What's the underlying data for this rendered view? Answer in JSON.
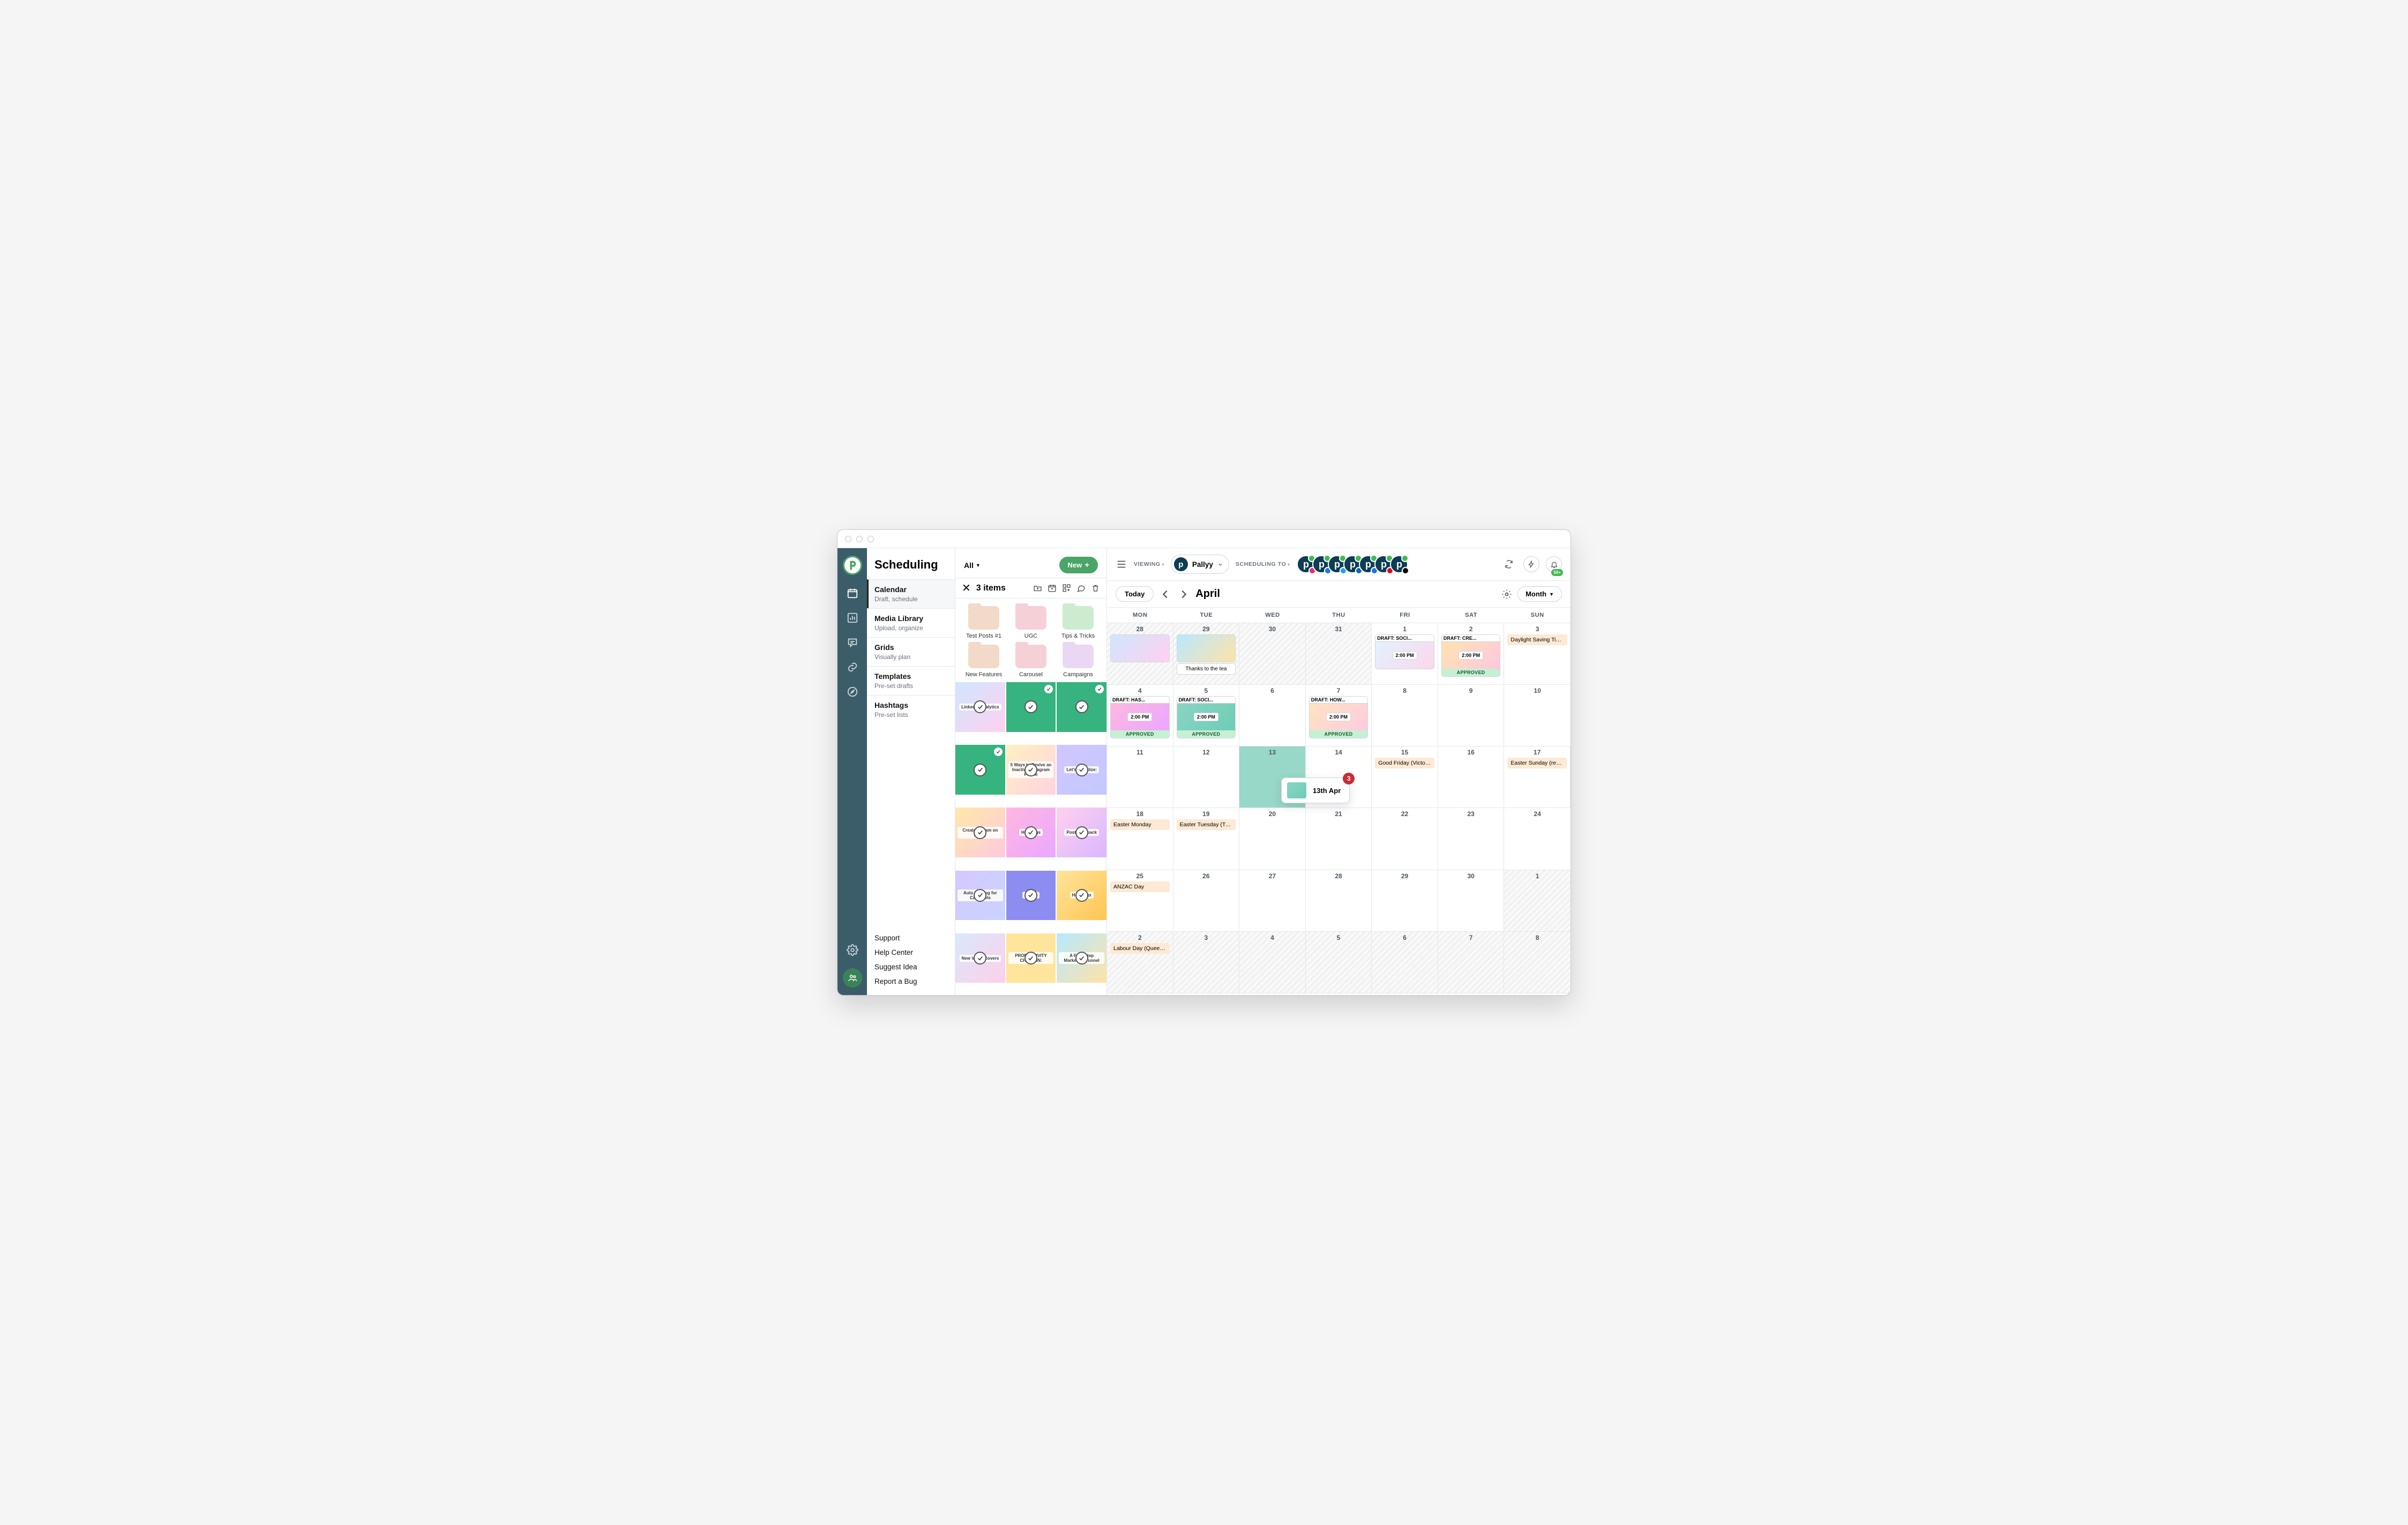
{
  "title": "Scheduling",
  "nav": [
    {
      "title": "Calendar",
      "subtitle": "Draft, schedule",
      "active": true
    },
    {
      "title": "Media Library",
      "subtitle": "Upload, organize"
    },
    {
      "title": "Grids",
      "subtitle": "Visually plan"
    },
    {
      "title": "Templates",
      "subtitle": "Pre-set drafts"
    },
    {
      "title": "Hashtags",
      "subtitle": "Pre-set lists"
    }
  ],
  "footerNav": [
    "Support",
    "Help Center",
    "Suggest Idea",
    "Report a Bug"
  ],
  "media": {
    "filter": "All",
    "newLabel": "New",
    "selectedLabel": "3 items",
    "folders": [
      {
        "name": "Test Posts #1",
        "color": "#f2d9c8"
      },
      {
        "name": "UGC",
        "color": "#f6d0d7"
      },
      {
        "name": "Tips & Tricks",
        "color": "#cdeccf"
      },
      {
        "name": "New Features",
        "color": "#f2d9c8"
      },
      {
        "name": "Carousel",
        "color": "#f6d0d7"
      },
      {
        "name": "Campaigns",
        "color": "#e9d7f3"
      }
    ],
    "thumbs": [
      {
        "bg": "linear-gradient(135deg,#d0e6ff,#ffd1ef)",
        "label": "LinkedIn Analytics",
        "sel": false
      },
      {
        "bg": "#36b37e",
        "label": "",
        "sel": true
      },
      {
        "bg": "#36b37e",
        "label": "",
        "sel": true
      },
      {
        "bg": "#36b37e",
        "label": "",
        "sel": true
      },
      {
        "bg": "linear-gradient(135deg,#fff0c0,#ffd3e0)",
        "label": "5 Ways to Revive an Inactive Instagram Profile",
        "sel": false
      },
      {
        "bg": "linear-gradient(135deg,#d2c6ff,#c2c8ff)",
        "label": "Let's socialize:",
        "sel": false
      },
      {
        "bg": "linear-gradient(135deg,#ffe9a8,#ffc9de)",
        "label": "Create a Team on Pallyy",
        "sel": false
      },
      {
        "bg": "linear-gradient(135deg,#ffb7e0,#eaa7ff)",
        "label": "Hashtags",
        "sel": false
      },
      {
        "bg": "linear-gradient(135deg,#ffd0ee,#d9b7ff)",
        "label": "Post Feedback",
        "sel": false
      },
      {
        "bg": "linear-gradient(135deg,#d6c8ff,#c9d3ff)",
        "label": "Auto Posting for Carousels",
        "sel": false
      },
      {
        "bg": "#8d8cf0",
        "label": "Pallyy",
        "sel": false
      },
      {
        "bg": "linear-gradient(135deg,#ffe49b,#ffc553)",
        "label": "Hashtags",
        "sel": false
      },
      {
        "bg": "linear-gradient(135deg,#d9e8ff,#fdd0e8)",
        "label": "New Video Covers",
        "sel": false
      },
      {
        "bg": "#ffe49b",
        "label": "PRODUCTIVITY CHECK IN:",
        "sel": false
      },
      {
        "bg": "linear-gradient(135deg,#b7e9ff,#ffe2a8)",
        "label": "A Four Step Marketing Funnel",
        "sel": false
      }
    ]
  },
  "header": {
    "viewing": "VIEWING",
    "brand": "Pallyy",
    "schedulingTo": "SCHEDULING TO",
    "channels": [
      {
        "net": "instagram",
        "color": "#e1306c"
      },
      {
        "net": "facebook",
        "color": "#1877f2"
      },
      {
        "net": "twitter",
        "color": "#1da1f2"
      },
      {
        "net": "linkedin",
        "color": "#0a66c2"
      },
      {
        "net": "gmb",
        "color": "#1a73e8"
      },
      {
        "net": "pinterest",
        "color": "#e60023"
      },
      {
        "net": "tiktok",
        "color": "#000000"
      }
    ],
    "notifCount": "50+"
  },
  "calendarCtrl": {
    "today": "Today",
    "month": "April",
    "view": "Month"
  },
  "dow": [
    "MON",
    "TUE",
    "WED",
    "THU",
    "FRI",
    "SAT",
    "SUN"
  ],
  "weeks": [
    {
      "days": [
        {
          "n": "28",
          "off": true,
          "posts": [
            {
              "img": "linear-gradient(135deg,#d0e6ff,#ffd1ef)"
            }
          ]
        },
        {
          "n": "29",
          "off": true,
          "posts": [
            {
              "img": "linear-gradient(135deg,#b7e9ff,#ffe2a8)"
            }
          ],
          "more": "Thanks to the tea"
        },
        {
          "n": "30",
          "off": true
        },
        {
          "n": "31",
          "off": true
        },
        {
          "n": "1",
          "posts": [
            {
              "draft": "DRAFT: SOCI...",
              "img": "linear-gradient(135deg,#e2f2ff,#fbd7ec)",
              "time": "2:00 PM"
            }
          ]
        },
        {
          "n": "2",
          "posts": [
            {
              "draft": "DRAFT: CRE...",
              "img": "linear-gradient(135deg,#ffe4ae,#ffc7df)",
              "time": "2:00 PM",
              "approved": true
            }
          ]
        },
        {
          "n": "3",
          "holiday": "Daylight Saving Tim..."
        }
      ]
    },
    {
      "days": [
        {
          "n": "4",
          "posts": [
            {
              "draft": "DRAFT: HAS...",
              "img": "linear-gradient(135deg,#ffb7e0,#eaa7ff)",
              "time": "2:00 PM",
              "approved": true
            }
          ]
        },
        {
          "n": "5",
          "posts": [
            {
              "draft": "DRAFT: SOCI...",
              "img": "linear-gradient(135deg,#8ad4c4,#6ecdb5)",
              "time": "2:00 PM",
              "approved": true
            }
          ]
        },
        {
          "n": "6"
        },
        {
          "n": "7",
          "posts": [
            {
              "draft": "DRAFT: HOW...",
              "img": "linear-gradient(135deg,#ffe4c0,#ffcbe0)",
              "time": "2:00 PM",
              "approved": true
            }
          ]
        },
        {
          "n": "8"
        },
        {
          "n": "9"
        },
        {
          "n": "10"
        }
      ]
    },
    {
      "days": [
        {
          "n": "11"
        },
        {
          "n": "12"
        },
        {
          "n": "13",
          "drop": true
        },
        {
          "n": "14"
        },
        {
          "n": "15",
          "holiday": "Good Friday (Victor..."
        },
        {
          "n": "16"
        },
        {
          "n": "17",
          "holiday": "Easter Sunday (regi..."
        }
      ],
      "dragging": {
        "label": "13th Apr",
        "count": "3"
      }
    },
    {
      "days": [
        {
          "n": "18",
          "holiday": "Easter Monday"
        },
        {
          "n": "19",
          "holiday": "Easter Tuesday (Ta..."
        },
        {
          "n": "20"
        },
        {
          "n": "21"
        },
        {
          "n": "22"
        },
        {
          "n": "23"
        },
        {
          "n": "24"
        }
      ]
    },
    {
      "days": [
        {
          "n": "25",
          "holiday": "ANZAC Day"
        },
        {
          "n": "26"
        },
        {
          "n": "27"
        },
        {
          "n": "28"
        },
        {
          "n": "29"
        },
        {
          "n": "30"
        },
        {
          "n": "1",
          "off": true
        }
      ]
    },
    {
      "days": [
        {
          "n": "2",
          "off": true,
          "holiday": "Labour Day (Queen..."
        },
        {
          "n": "3",
          "off": true
        },
        {
          "n": "4",
          "off": true
        },
        {
          "n": "5",
          "off": true
        },
        {
          "n": "6",
          "off": true
        },
        {
          "n": "7",
          "off": true
        },
        {
          "n": "8",
          "off": true
        }
      ]
    }
  ]
}
